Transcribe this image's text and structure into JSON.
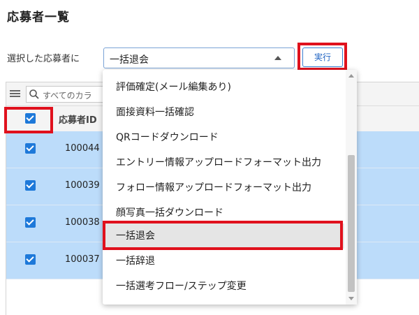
{
  "page": {
    "title": "応募者一覧"
  },
  "bulk_action": {
    "label": "選択した応募者に",
    "selected_value": "一括退会",
    "execute_label": "実行"
  },
  "grid": {
    "search_placeholder": "すべてのカラ",
    "header": {
      "id_label": "応募者ID"
    },
    "rows": [
      {
        "id": "100044",
        "checked": true
      },
      {
        "id": "100039",
        "checked": true
      },
      {
        "id": "100038",
        "checked": true
      },
      {
        "id": "100037",
        "checked": true
      }
    ]
  },
  "dropdown": {
    "options": [
      "評価確定(メール編集あり)",
      "面接資料一括確認",
      "QRコードダウンロード",
      "エントリー情報アップロードフォーマット出力",
      "フォロー情報アップロードフォーマット出力",
      "顔写真一括ダウンロード",
      "一括退会",
      "一括辞退",
      "一括選考フロー/ステップ変更"
    ],
    "selected_index": 6
  },
  "colors": {
    "highlight": "#e0111d",
    "selected_row": "#bcdcfa",
    "checkbox": "#1e79d9",
    "button_text": "#1f63c2"
  }
}
